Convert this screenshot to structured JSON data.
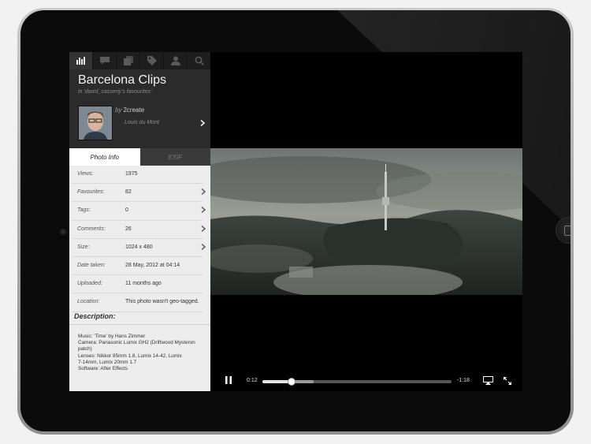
{
  "tabs": [
    {
      "icon": "stats-icon",
      "active": true
    },
    {
      "icon": "comments-icon",
      "active": false
    },
    {
      "icon": "sets-icon",
      "active": false
    },
    {
      "icon": "tag-icon",
      "active": false
    },
    {
      "icon": "user-icon",
      "active": false
    },
    {
      "icon": "search-icon",
      "active": false
    }
  ],
  "photo": {
    "title": "Barcelona Clips",
    "subtitle": "in 'david_casseriy's favourites'",
    "by_label": "by",
    "owner": "2create",
    "owner_realname": "Louis du Mont"
  },
  "info_tabs": {
    "photo_info": "Photo Info",
    "exif": "EXIF"
  },
  "info_rows": [
    {
      "label": "Views:",
      "value": "1975",
      "chevron": false
    },
    {
      "label": "Favourites:",
      "value": "82",
      "chevron": true
    },
    {
      "label": "Tags:",
      "value": "0",
      "chevron": true
    },
    {
      "label": "Comments:",
      "value": "26",
      "chevron": true
    },
    {
      "label": "Size:",
      "value": "1024 x 480",
      "chevron": true
    },
    {
      "label": "Date taken:",
      "value": "28 May, 2012 at 04:14",
      "chevron": false
    },
    {
      "label": "Uploaded:",
      "value": "11 months ago",
      "chevron": false
    },
    {
      "label": "Location:",
      "value": "This photo wasn't geo-tagged.",
      "chevron": false
    }
  ],
  "description": {
    "heading": "Description:",
    "lines": [
      "Music: 'Time' by Hans Zimmer",
      "Camera: Panasonic Lumix GH2 (Driftwood Mysteron",
      "patch)",
      "Lenses: Nikkor 85mm 1.8, Lumix 14-42, Lumix",
      "7-14mm, Lumix 20mm 1.7",
      "Software: After Effects"
    ]
  },
  "player": {
    "current_time": "0:12",
    "remaining_time": "-1:18",
    "progress": 0.15,
    "buffered": 0.27
  },
  "colors": {
    "bezel": "#0b0b0b",
    "sidebar": "#2b2b2b",
    "panel": "#ededed"
  }
}
